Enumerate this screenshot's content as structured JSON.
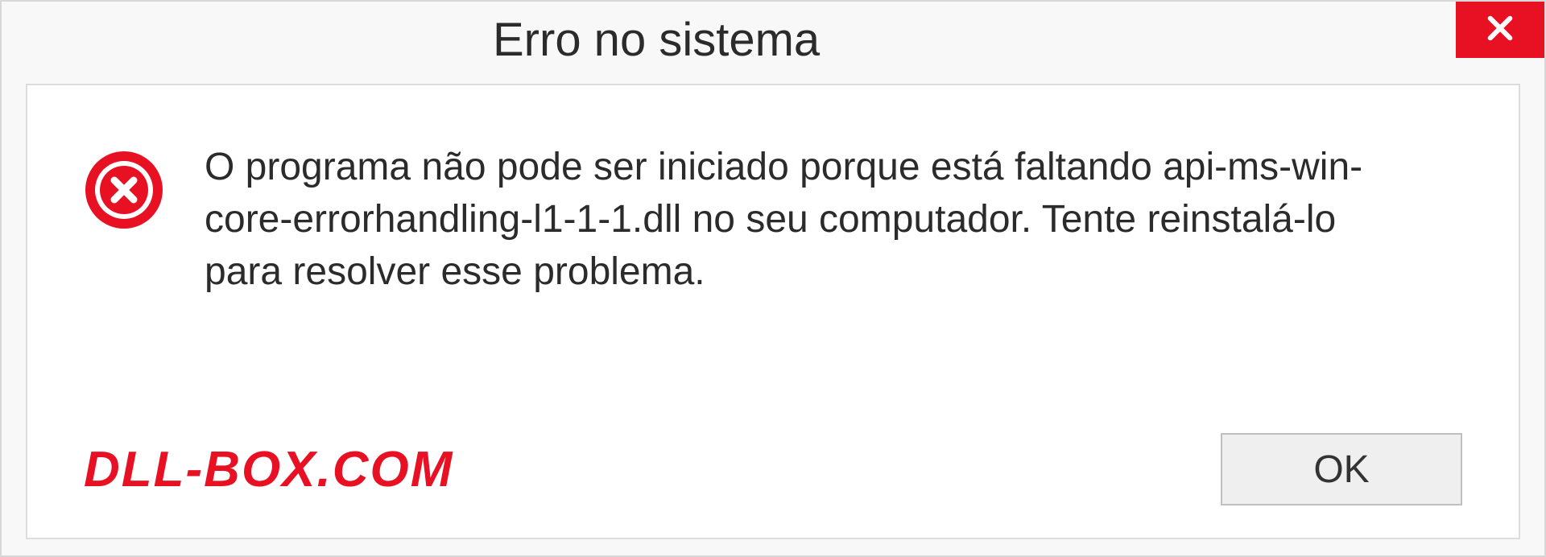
{
  "titlebar": {
    "title": "Erro no sistema"
  },
  "body": {
    "message": "O programa não pode ser iniciado porque está faltando api-ms-win-core-errorhandling-l1-1-1.dll no seu computador. Tente reinstalá-lo para resolver esse problema."
  },
  "footer": {
    "watermark": "DLL-BOX.COM",
    "ok_label": "OK"
  },
  "icons": {
    "close": "close-icon",
    "error": "error-icon"
  },
  "colors": {
    "accent_red": "#e81123",
    "bg_gray": "#f8f8f8",
    "border_gray": "#dcdcdc",
    "text": "#2b2b2b"
  }
}
